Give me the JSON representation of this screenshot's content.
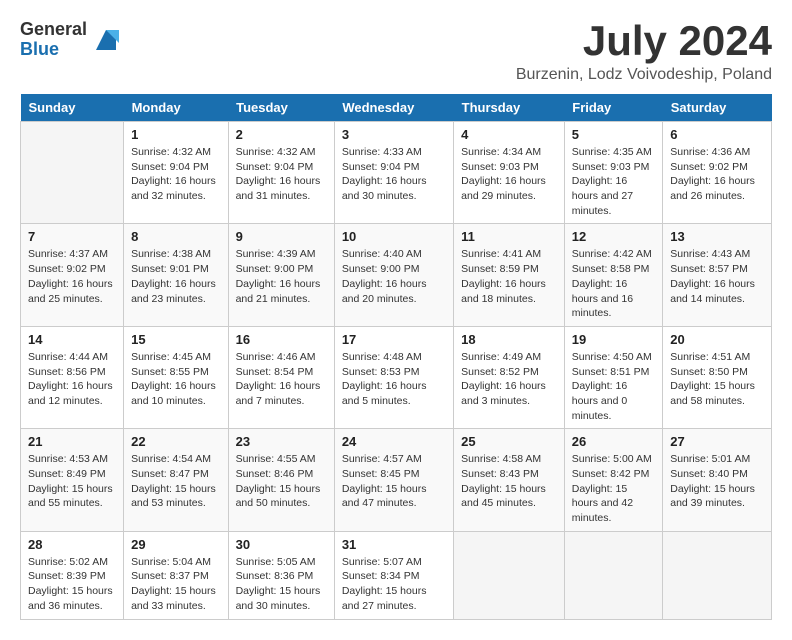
{
  "header": {
    "logo_general": "General",
    "logo_blue": "Blue",
    "month_title": "July 2024",
    "location": "Burzenin, Lodz Voivodeship, Poland"
  },
  "days_of_week": [
    "Sunday",
    "Monday",
    "Tuesday",
    "Wednesday",
    "Thursday",
    "Friday",
    "Saturday"
  ],
  "weeks": [
    [
      {
        "date": "",
        "text": ""
      },
      {
        "date": "1",
        "text": "Sunrise: 4:32 AM\nSunset: 9:04 PM\nDaylight: 16 hours and 32 minutes."
      },
      {
        "date": "2",
        "text": "Sunrise: 4:32 AM\nSunset: 9:04 PM\nDaylight: 16 hours and 31 minutes."
      },
      {
        "date": "3",
        "text": "Sunrise: 4:33 AM\nSunset: 9:04 PM\nDaylight: 16 hours and 30 minutes."
      },
      {
        "date": "4",
        "text": "Sunrise: 4:34 AM\nSunset: 9:03 PM\nDaylight: 16 hours and 29 minutes."
      },
      {
        "date": "5",
        "text": "Sunrise: 4:35 AM\nSunset: 9:03 PM\nDaylight: 16 hours and 27 minutes."
      },
      {
        "date": "6",
        "text": "Sunrise: 4:36 AM\nSunset: 9:02 PM\nDaylight: 16 hours and 26 minutes."
      }
    ],
    [
      {
        "date": "7",
        "text": "Sunrise: 4:37 AM\nSunset: 9:02 PM\nDaylight: 16 hours and 25 minutes."
      },
      {
        "date": "8",
        "text": "Sunrise: 4:38 AM\nSunset: 9:01 PM\nDaylight: 16 hours and 23 minutes."
      },
      {
        "date": "9",
        "text": "Sunrise: 4:39 AM\nSunset: 9:00 PM\nDaylight: 16 hours and 21 minutes."
      },
      {
        "date": "10",
        "text": "Sunrise: 4:40 AM\nSunset: 9:00 PM\nDaylight: 16 hours and 20 minutes."
      },
      {
        "date": "11",
        "text": "Sunrise: 4:41 AM\nSunset: 8:59 PM\nDaylight: 16 hours and 18 minutes."
      },
      {
        "date": "12",
        "text": "Sunrise: 4:42 AM\nSunset: 8:58 PM\nDaylight: 16 hours and 16 minutes."
      },
      {
        "date": "13",
        "text": "Sunrise: 4:43 AM\nSunset: 8:57 PM\nDaylight: 16 hours and 14 minutes."
      }
    ],
    [
      {
        "date": "14",
        "text": "Sunrise: 4:44 AM\nSunset: 8:56 PM\nDaylight: 16 hours and 12 minutes."
      },
      {
        "date": "15",
        "text": "Sunrise: 4:45 AM\nSunset: 8:55 PM\nDaylight: 16 hours and 10 minutes."
      },
      {
        "date": "16",
        "text": "Sunrise: 4:46 AM\nSunset: 8:54 PM\nDaylight: 16 hours and 7 minutes."
      },
      {
        "date": "17",
        "text": "Sunrise: 4:48 AM\nSunset: 8:53 PM\nDaylight: 16 hours and 5 minutes."
      },
      {
        "date": "18",
        "text": "Sunrise: 4:49 AM\nSunset: 8:52 PM\nDaylight: 16 hours and 3 minutes."
      },
      {
        "date": "19",
        "text": "Sunrise: 4:50 AM\nSunset: 8:51 PM\nDaylight: 16 hours and 0 minutes."
      },
      {
        "date": "20",
        "text": "Sunrise: 4:51 AM\nSunset: 8:50 PM\nDaylight: 15 hours and 58 minutes."
      }
    ],
    [
      {
        "date": "21",
        "text": "Sunrise: 4:53 AM\nSunset: 8:49 PM\nDaylight: 15 hours and 55 minutes."
      },
      {
        "date": "22",
        "text": "Sunrise: 4:54 AM\nSunset: 8:47 PM\nDaylight: 15 hours and 53 minutes."
      },
      {
        "date": "23",
        "text": "Sunrise: 4:55 AM\nSunset: 8:46 PM\nDaylight: 15 hours and 50 minutes."
      },
      {
        "date": "24",
        "text": "Sunrise: 4:57 AM\nSunset: 8:45 PM\nDaylight: 15 hours and 47 minutes."
      },
      {
        "date": "25",
        "text": "Sunrise: 4:58 AM\nSunset: 8:43 PM\nDaylight: 15 hours and 45 minutes."
      },
      {
        "date": "26",
        "text": "Sunrise: 5:00 AM\nSunset: 8:42 PM\nDaylight: 15 hours and 42 minutes."
      },
      {
        "date": "27",
        "text": "Sunrise: 5:01 AM\nSunset: 8:40 PM\nDaylight: 15 hours and 39 minutes."
      }
    ],
    [
      {
        "date": "28",
        "text": "Sunrise: 5:02 AM\nSunset: 8:39 PM\nDaylight: 15 hours and 36 minutes."
      },
      {
        "date": "29",
        "text": "Sunrise: 5:04 AM\nSunset: 8:37 PM\nDaylight: 15 hours and 33 minutes."
      },
      {
        "date": "30",
        "text": "Sunrise: 5:05 AM\nSunset: 8:36 PM\nDaylight: 15 hours and 30 minutes."
      },
      {
        "date": "31",
        "text": "Sunrise: 5:07 AM\nSunset: 8:34 PM\nDaylight: 15 hours and 27 minutes."
      },
      {
        "date": "",
        "text": ""
      },
      {
        "date": "",
        "text": ""
      },
      {
        "date": "",
        "text": ""
      }
    ]
  ]
}
